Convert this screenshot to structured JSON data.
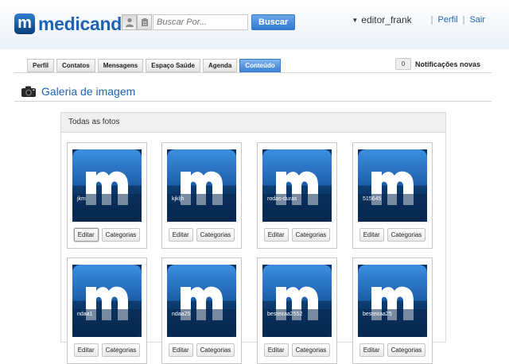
{
  "header": {
    "logo_letter": "m",
    "logo_text": "medicando",
    "search_placeholder": "Buscar Por...",
    "search_button": "Buscar",
    "username": "editor_frank",
    "profile_link": "Perfil",
    "logout_link": "Sair",
    "separator": "|"
  },
  "tabs": [
    {
      "label": "Perfil"
    },
    {
      "label": "Contatos"
    },
    {
      "label": "Mensagens"
    },
    {
      "label": "Espaço Saúde"
    },
    {
      "label": "Agenda"
    },
    {
      "label": "Conteúdo",
      "active": true
    }
  ],
  "notifications": {
    "count": "0",
    "label": "Notificações novas"
  },
  "page": {
    "title": "Galeria de imagem"
  },
  "panel": {
    "title": "Todas as fotos"
  },
  "gallery": {
    "edit_label": "Editar",
    "categories_label": "Categorias",
    "items": [
      {
        "caption": "jkm"
      },
      {
        "caption": "kjkljh"
      },
      {
        "caption": "rodas-duras"
      },
      {
        "caption": "515645"
      },
      {
        "caption": "ndaa1"
      },
      {
        "caption": "ndaa25"
      },
      {
        "caption": "besteiraa2552"
      },
      {
        "caption": "besteiraa25"
      }
    ]
  },
  "colors": {
    "brand": "#1f63b5",
    "accent_button": "#3278cf",
    "thumb_dark": "#0b3e7a"
  }
}
